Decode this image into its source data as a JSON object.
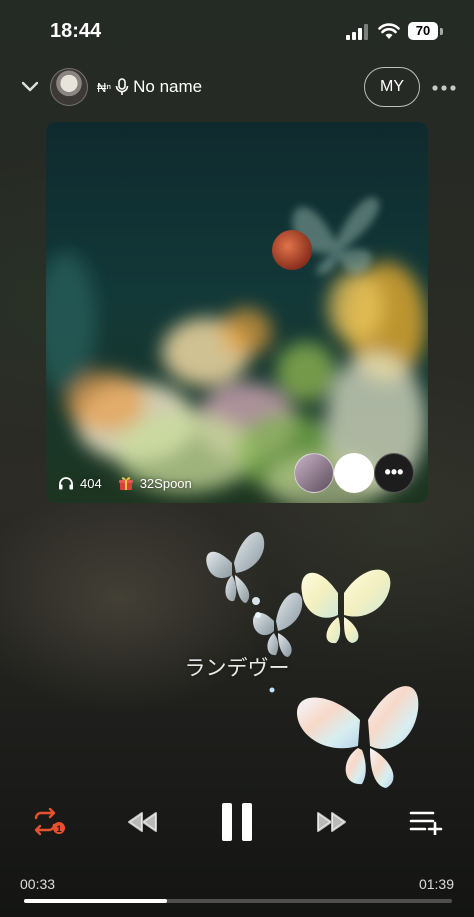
{
  "status_bar": {
    "time": "18:44",
    "battery": "70"
  },
  "header": {
    "dj_prefix": "₦ⁿ",
    "dj_name": "No name",
    "my_label": "MY"
  },
  "artwork": {
    "listeners": "404",
    "spoon_count": "32Spoon",
    "more_label": "•••"
  },
  "song": {
    "title": "ランデヴー"
  },
  "controls": {
    "repeat_color": "#e9502e",
    "repeat_badge": "1"
  },
  "progress": {
    "current": "00:33",
    "total": "01:39",
    "fraction": 0.333
  },
  "icons": [
    "chevron-down-icon",
    "microphone-icon",
    "more-icon",
    "headphones-icon",
    "gift-icon",
    "repeat-one-icon",
    "previous-icon",
    "pause-icon",
    "next-icon",
    "add-to-queue-icon"
  ]
}
